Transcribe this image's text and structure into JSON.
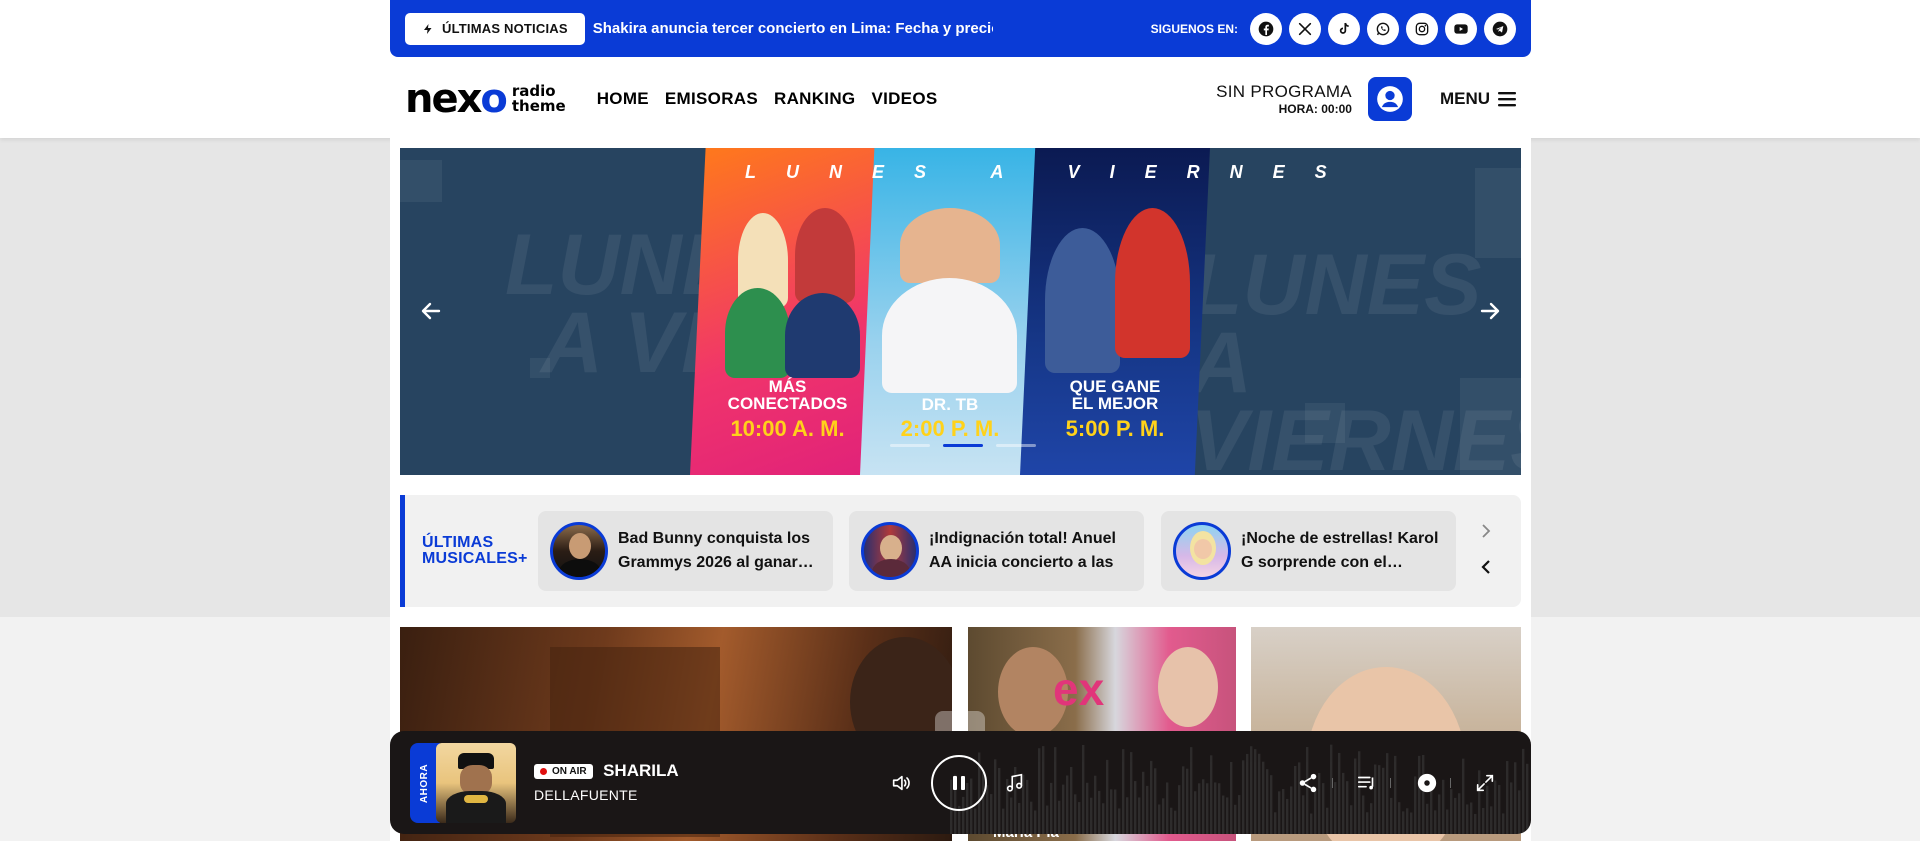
{
  "breaking": {
    "badge": "ÚLTIMAS NOTICIAS",
    "headline": "Shakira anuncia tercer concierto en Lima: Fecha y precios",
    "follow_label": "SIGUENOS EN:",
    "socials": [
      "facebook-icon",
      "x-icon",
      "tiktok-icon",
      "whatsapp-icon",
      "instagram-icon",
      "youtube-icon",
      "telegram-icon"
    ]
  },
  "brand": {
    "name_a": "nex",
    "name_b": "o",
    "sub_1": "radio",
    "sub_2": "theme",
    "accent": "#0a3bd6"
  },
  "nav": {
    "items": [
      "HOME",
      "EMISORAS",
      "RANKING",
      "VIDEOS"
    ]
  },
  "program": {
    "title": "SIN PROGRAMA",
    "time": "HORA: 00:00"
  },
  "menu": {
    "label": "MENU"
  },
  "hero": {
    "week": "LUNES A VIERNES",
    "bg_left_1": "LUNES",
    "bg_left_2": "A VIERNES",
    "bg_right_1": "LUNES",
    "bg_right_2": "A VIERNES",
    "shows": [
      {
        "name_1": "MÁS",
        "name_2": "CONECTADOS",
        "time": "10:00 A. M."
      },
      {
        "name_1": "",
        "name_2": "DR. TB",
        "time": "2:00 P. M."
      },
      {
        "name_1": "QUE GANE",
        "name_2": "EL MEJOR",
        "time": "5:00 P. M."
      }
    ],
    "active_slide": 2,
    "slide_count": 3
  },
  "latest": {
    "title_1": "ÚLTIMAS",
    "title_2": "MUSICALES+",
    "items": [
      {
        "text": "Bad Bunny conquista los Grammys 2026 al ganar…"
      },
      {
        "text": "¡Indignación total! Anuel AA inicia concierto a las …"
      },
      {
        "text": "¡Noche de estrellas! Karol G sorprende con el…"
      }
    ]
  },
  "tiles": {
    "caption_2": "María Pía"
  },
  "player": {
    "now_label": "AHORA",
    "onair": "ON AIR",
    "title": "SHARILA",
    "artist": "DELLAFUENTE"
  }
}
